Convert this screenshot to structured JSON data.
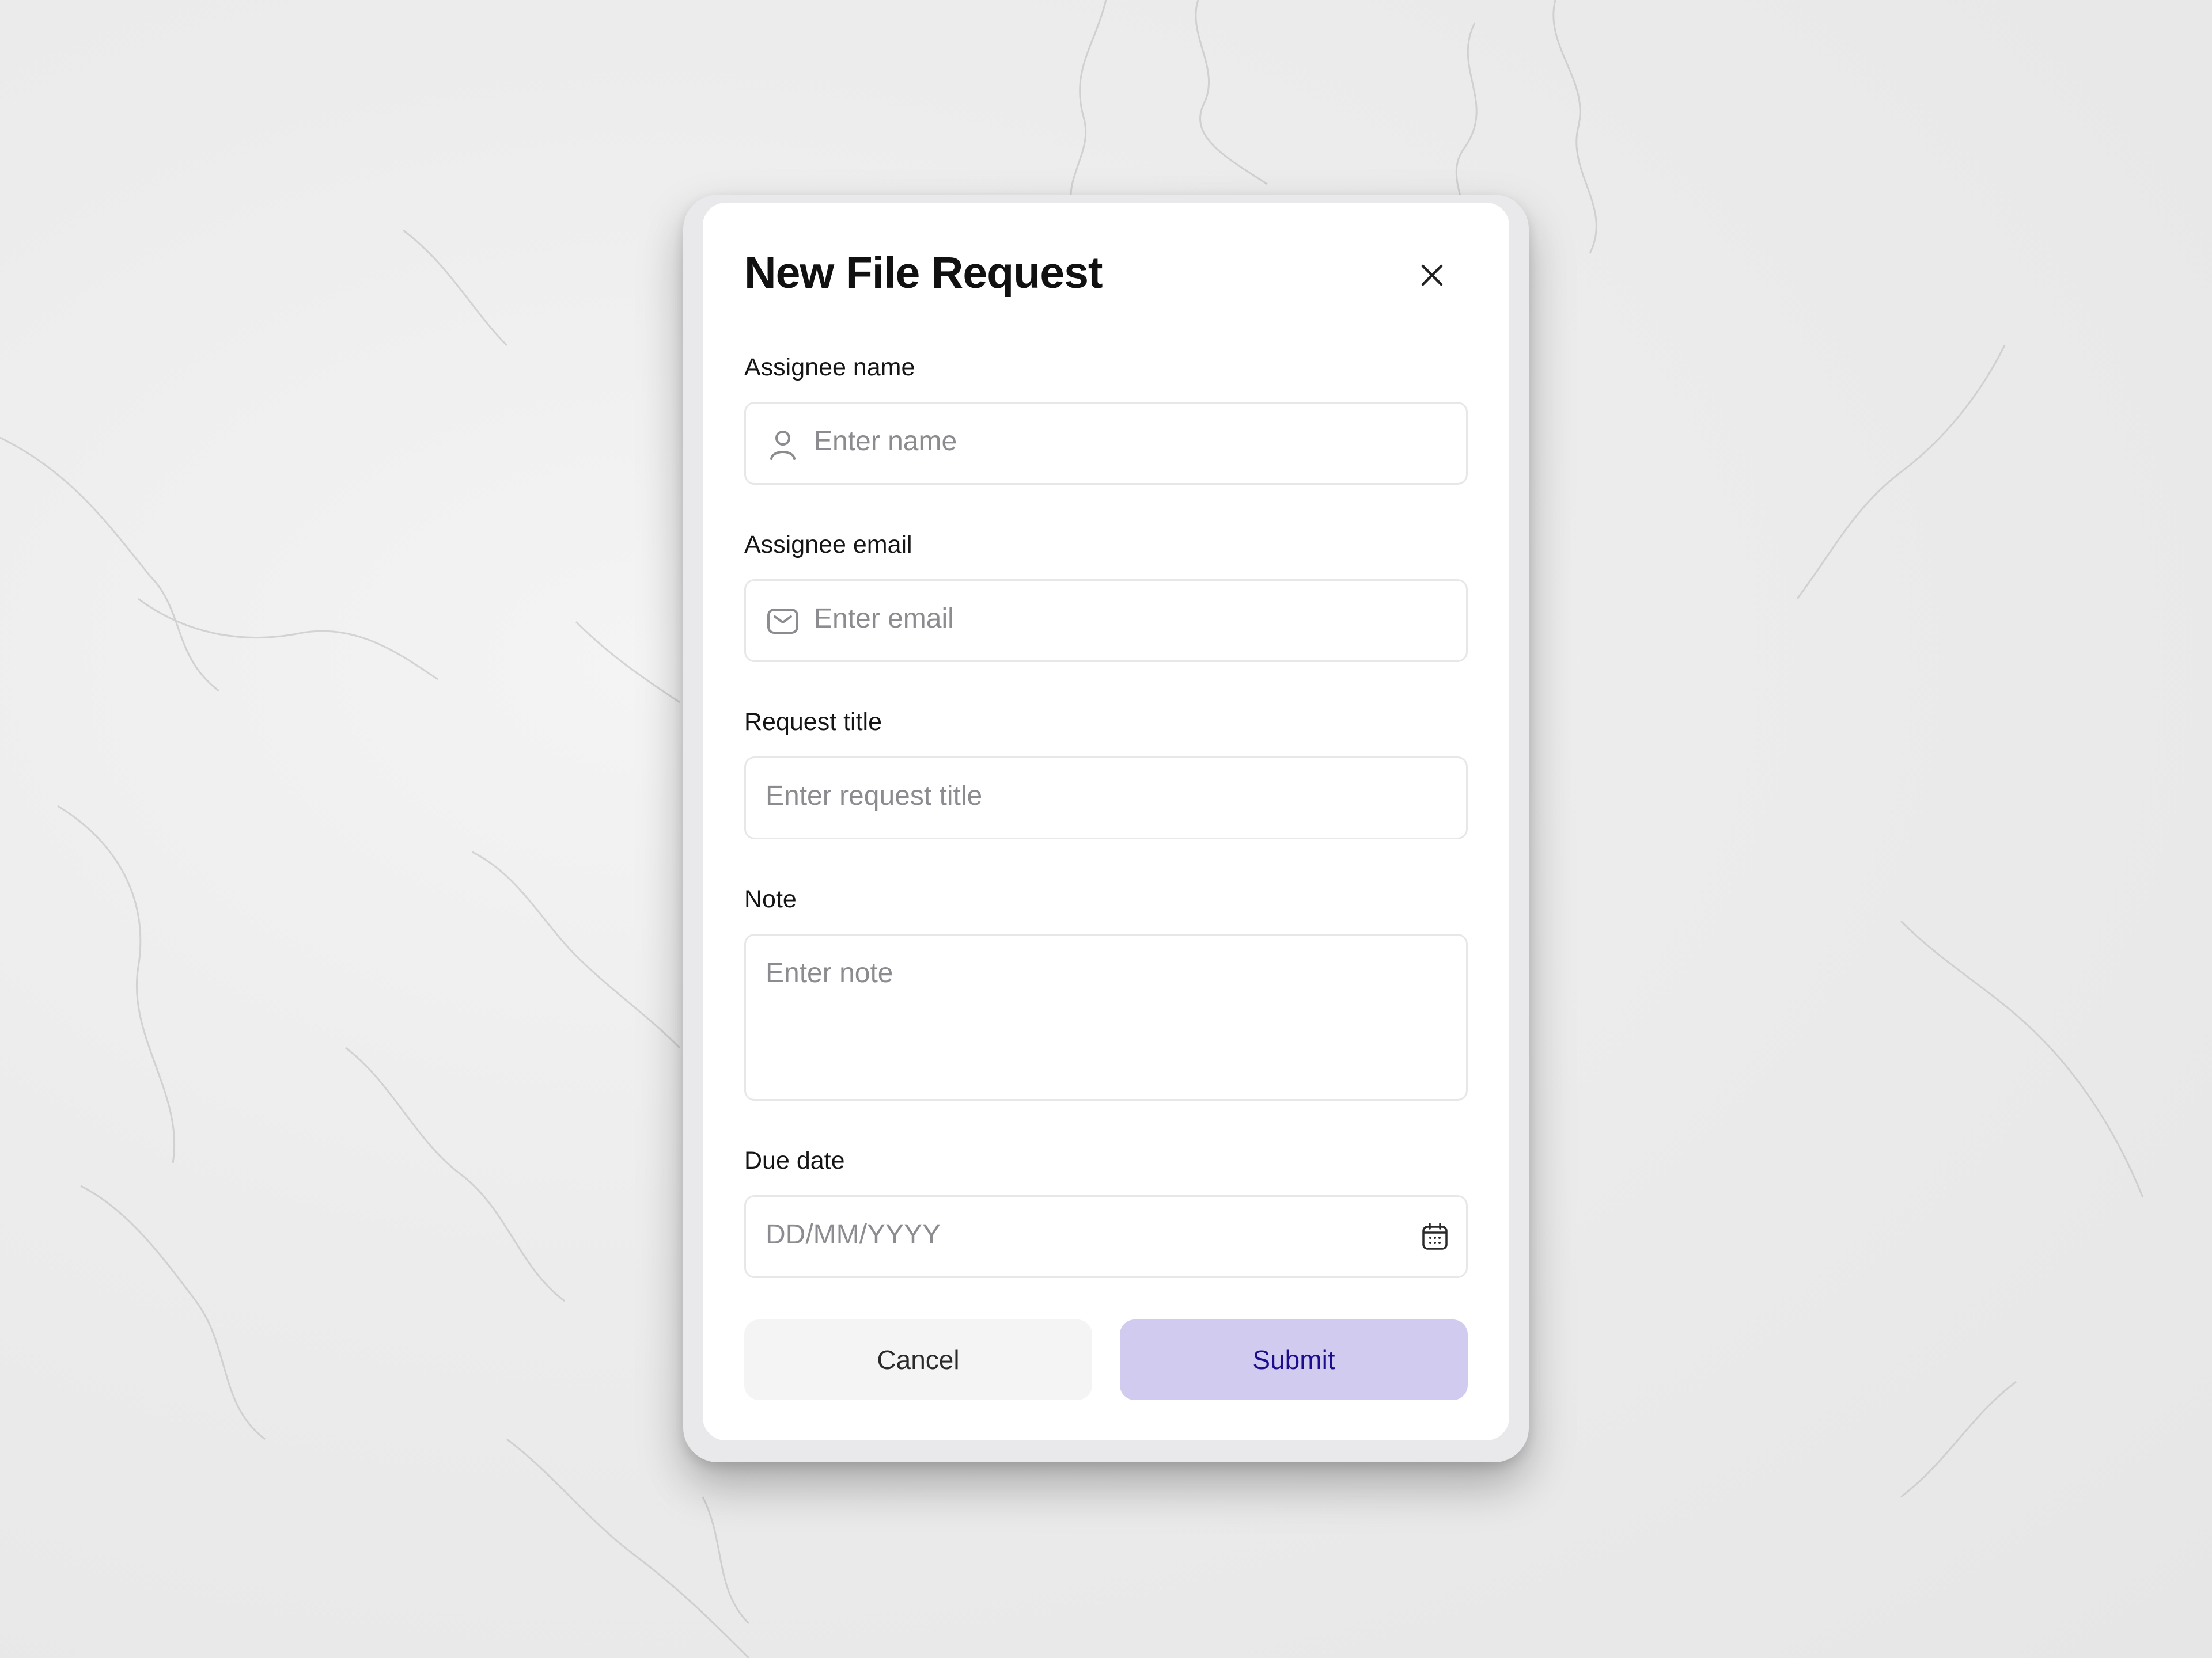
{
  "modal": {
    "title": "New File Request",
    "close_icon": "close-icon"
  },
  "fields": {
    "assignee_name": {
      "label": "Assignee name",
      "placeholder": "Enter  name",
      "icon": "user-icon"
    },
    "assignee_email": {
      "label": "Assignee email",
      "placeholder": "Enter  email",
      "icon": "mail-icon"
    },
    "request_title": {
      "label": "Request title",
      "placeholder": "Enter request title"
    },
    "note": {
      "label": "Note",
      "placeholder": "Enter note"
    },
    "due_date": {
      "label": "Due date",
      "placeholder": "DD/MM/YYYY",
      "icon": "calendar-icon"
    }
  },
  "actions": {
    "cancel_label": "Cancel",
    "submit_label": "Submit"
  },
  "colors": {
    "submit_bg": "#d2cbf0",
    "submit_text": "#1b0d8e",
    "cancel_bg": "#f4f4f5",
    "background": "#ececec"
  }
}
